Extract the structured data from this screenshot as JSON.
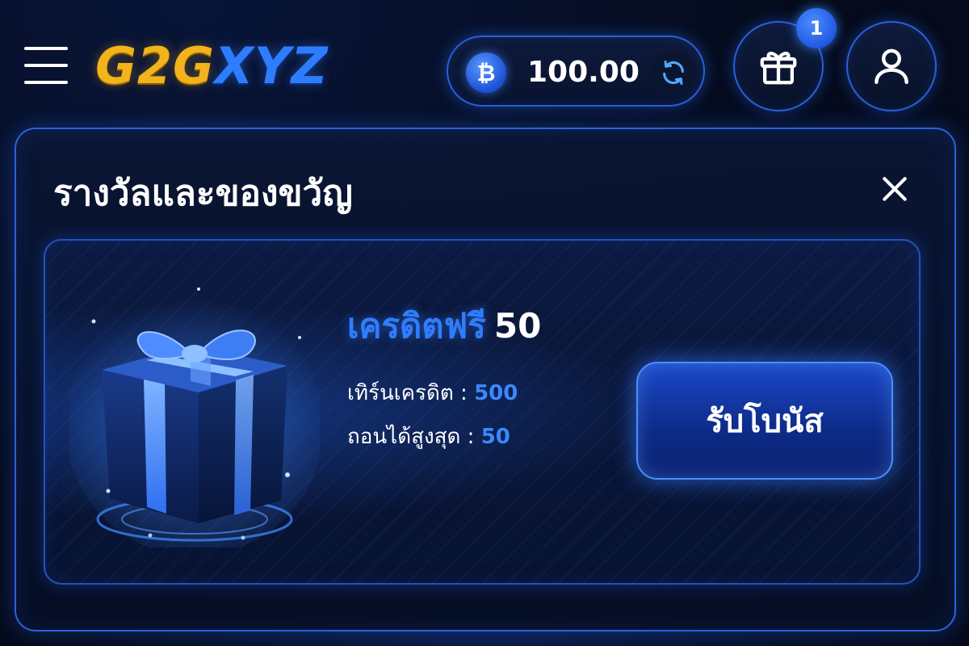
{
  "header": {
    "menu_icon": "hamburger-menu-icon",
    "logo": {
      "part1": "G2G",
      "part2": "XYZ"
    },
    "balance": {
      "currency_icon": "bitcoin-icon",
      "currency_symbol": "₿",
      "amount": "100.00",
      "refresh_icon": "refresh-icon"
    },
    "gift": {
      "icon": "gift-icon",
      "badge_count": "1"
    },
    "profile": {
      "icon": "user-icon"
    }
  },
  "modal": {
    "title": "รางวัลและของขวัญ",
    "close_icon": "close-icon",
    "bonus": {
      "image_icon": "gift-box-illustration",
      "name": "เครดิตฟรี",
      "amount": "50",
      "turnover_label": "เทิร์นเครดิต :",
      "turnover_value": "500",
      "max_withdraw_label": "ถอนได้สูงสุด :",
      "max_withdraw_value": "50",
      "claim_label": "รับโบนัส"
    }
  },
  "colors": {
    "background": "#050b1c",
    "accent_blue": "#2f7dff",
    "logo_gold": "#f2b31b",
    "border_blue": "#2a5fd8"
  }
}
